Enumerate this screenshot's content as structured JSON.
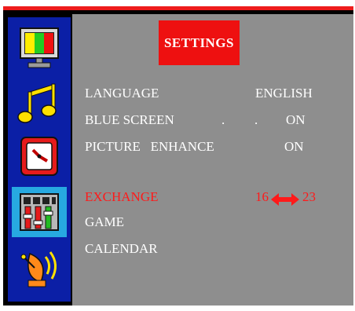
{
  "menu": {
    "title": "SETTINGS",
    "items": [
      {
        "label": "LANGUAGE",
        "value": "ENGLISH"
      },
      {
        "label": "BLUE SCREEN",
        "value": "ON"
      },
      {
        "label": "PICTURE   ENHANCE",
        "value": "ON"
      },
      {
        "label": "EXCHANGE",
        "value_left": "16",
        "value_right": "23"
      },
      {
        "label": "GAME"
      },
      {
        "label": "CALENDAR"
      }
    ],
    "dots": [
      ".",
      "."
    ]
  },
  "sidebar": {
    "icons": [
      {
        "name": "monitor-color-bars-icon",
        "selected": false
      },
      {
        "name": "music-notes-icon",
        "selected": false
      },
      {
        "name": "clock-icon",
        "selected": false
      },
      {
        "name": "settings-tools-icon",
        "selected": true
      },
      {
        "name": "satellite-dish-icon",
        "selected": false
      }
    ]
  },
  "colors": {
    "accent_red": "#ee1010",
    "sidebar_blue": "#0b1fa6",
    "selected_blue": "#27a9e1",
    "panel_gray": "#8e8e8e"
  }
}
